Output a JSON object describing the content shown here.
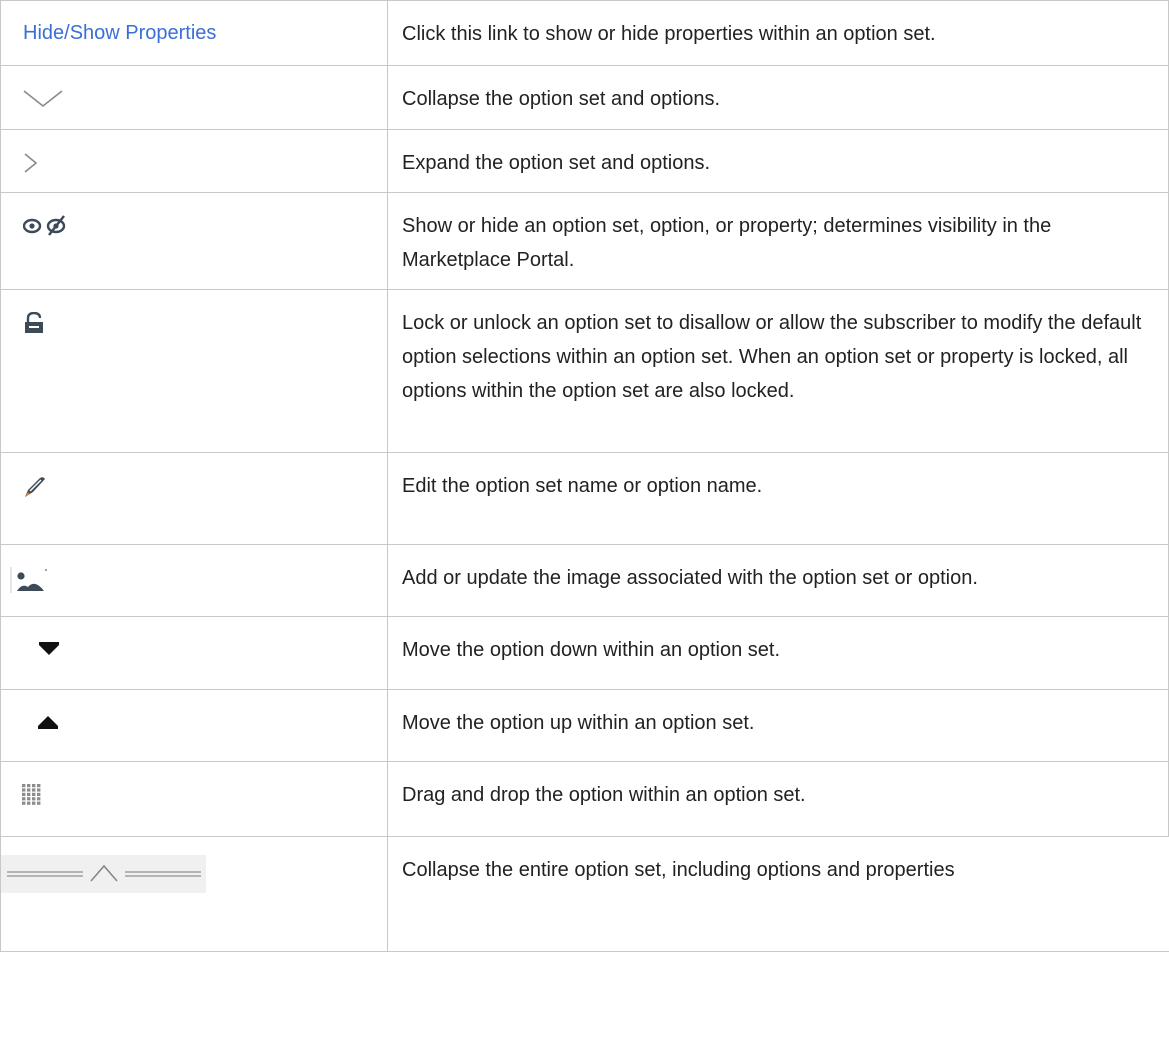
{
  "rows": [
    {
      "icon": "hide-show-properties-link",
      "link_label": "Hide/Show Properties",
      "description": "Click this link to show or hide properties within an option set."
    },
    {
      "icon": "chevron-down-icon",
      "description": "Collapse the option set and options."
    },
    {
      "icon": "chevron-right-icon",
      "description": "Expand the option set and options."
    },
    {
      "icon": "eye-visibility-icon",
      "description": "Show or hide an option set, option, or property; determines visibility in the Marketplace Portal."
    },
    {
      "icon": "lock-icon",
      "description": "Lock or unlock an option set to disallow or allow the subscriber to modify the default option selections within an option set. When an option set or property is locked, all options within the option set are also locked."
    },
    {
      "icon": "pencil-icon",
      "description": "Edit the option set name or option name."
    },
    {
      "icon": "image-icon",
      "description": "Add or update the image associated with the option set or option."
    },
    {
      "icon": "triangle-down-icon",
      "description": "Move the option down within an option set."
    },
    {
      "icon": "triangle-up-icon",
      "description": "Move the option up within an option set."
    },
    {
      "icon": "drag-grid-icon",
      "description": "Drag and drop the option within an option set."
    },
    {
      "icon": "collapse-all-bar-icon",
      "description": "Collapse the entire option set, including options and properties"
    }
  ],
  "colors": {
    "link": "#3b6fd6",
    "icon_dark": "#3d4a57",
    "border": "#c8c8c8"
  }
}
